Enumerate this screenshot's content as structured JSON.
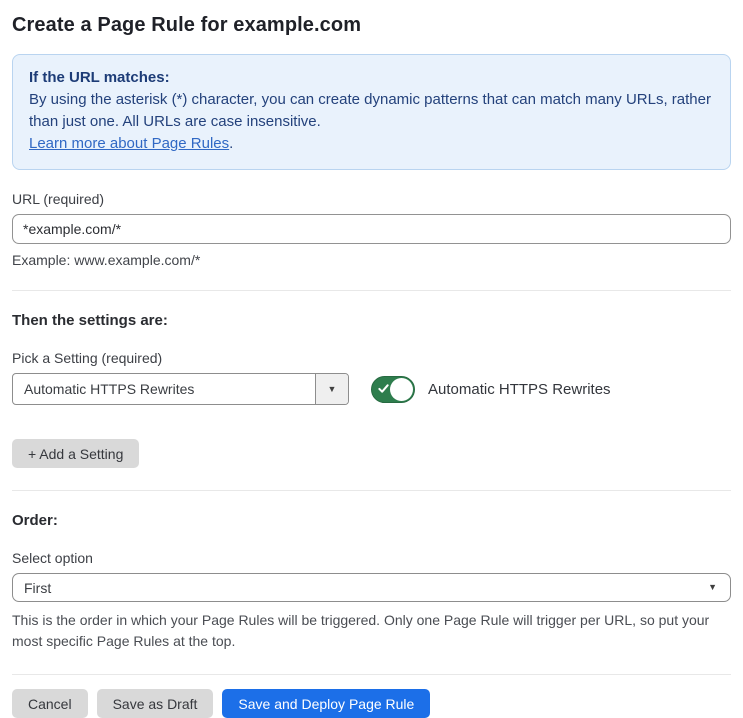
{
  "page": {
    "title": "Create a Page Rule for example.com"
  },
  "info_box": {
    "heading": "If the URL matches:",
    "body": "By using the asterisk (*) character, you can create dynamic patterns that can match many URLs, rather than just one. All URLs are case insensitive.",
    "link_label": "Learn more about Page Rules",
    "link_suffix": "."
  },
  "url_field": {
    "label": "URL (required)",
    "value": "*example.com/*",
    "helper": "Example: www.example.com/*"
  },
  "settings_section": {
    "heading": "Then the settings are:",
    "picker_label": "Pick a Setting (required)",
    "picker_value": "Automatic HTTPS Rewrites",
    "caret": "▼",
    "toggle_state": "on",
    "toggle_label": "Automatic HTTPS Rewrites",
    "add_setting_label": "+ Add a Setting"
  },
  "order_section": {
    "heading": "Order:",
    "select_label": "Select option",
    "select_value": "First",
    "caret": "▼",
    "helper": "This is the order in which your Page Rules will be triggered. Only one Page Rule will trigger per URL, so put your most specific Page Rules at the top."
  },
  "footer": {
    "cancel_label": "Cancel",
    "save_draft_label": "Save as Draft",
    "save_deploy_label": "Save and Deploy Page Rule"
  },
  "colors": {
    "info_bg": "#e9f2fc",
    "info_border": "#b9d4f0",
    "info_text": "#24427c",
    "link_blue": "#3068c4",
    "toggle_green": "#2e7d4d",
    "primary_blue": "#1c6fe8",
    "button_gray": "#d9d9d9"
  }
}
